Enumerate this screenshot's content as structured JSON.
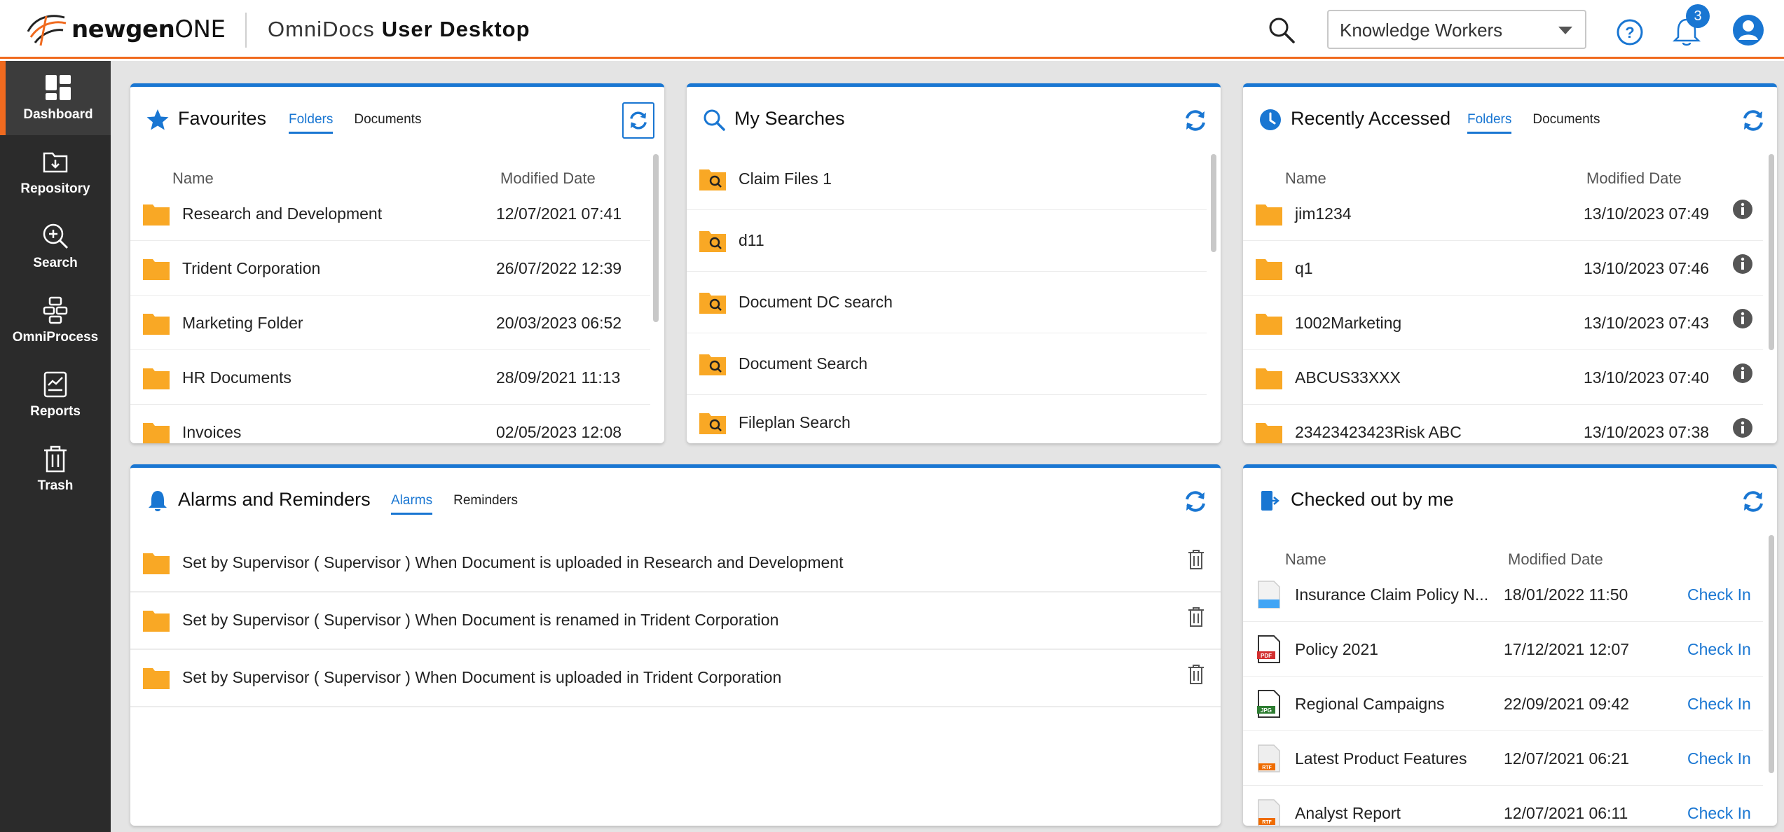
{
  "header": {
    "brand_main": "newgen",
    "brand_suffix": "ONE",
    "app_name": "OmniDocs",
    "app_subtitle": "User Desktop",
    "role_select": "Knowledge Workers",
    "notification_count": "3"
  },
  "sidebar": {
    "items": [
      {
        "label": "Dashboard",
        "icon": "dashboard-icon"
      },
      {
        "label": "Repository",
        "icon": "repository-icon"
      },
      {
        "label": "Search",
        "icon": "search-icon"
      },
      {
        "label": "OmniProcess",
        "icon": "omniprocess-icon"
      },
      {
        "label": "Reports",
        "icon": "reports-icon"
      },
      {
        "label": "Trash",
        "icon": "trash-icon"
      }
    ]
  },
  "favourites": {
    "title": "Favourites",
    "tabs": [
      "Folders",
      "Documents"
    ],
    "col_name": "Name",
    "col_date": "Modified Date",
    "rows": [
      {
        "name": "Research and Development",
        "date": "12/07/2021 07:41"
      },
      {
        "name": "Trident Corporation",
        "date": "26/07/2022 12:39"
      },
      {
        "name": "Marketing Folder",
        "date": "20/03/2023 06:52"
      },
      {
        "name": "HR Documents",
        "date": "28/09/2021 11:13"
      },
      {
        "name": "Invoices",
        "date": "02/05/2023 12:08"
      }
    ]
  },
  "searches": {
    "title": "My Searches",
    "rows": [
      "Claim Files 1",
      "d11",
      "Document DC search",
      "Document Search",
      "Fileplan Search"
    ]
  },
  "recent": {
    "title": "Recently Accessed",
    "tabs": [
      "Folders",
      "Documents"
    ],
    "col_name": "Name",
    "col_date": "Modified Date",
    "rows": [
      {
        "name": "jim1234",
        "date": "13/10/2023 07:49"
      },
      {
        "name": "q1",
        "date": "13/10/2023 07:46"
      },
      {
        "name": "1002Marketing",
        "date": "13/10/2023 07:43"
      },
      {
        "name": "ABCUS33XXX",
        "date": "13/10/2023 07:40"
      },
      {
        "name": "23423423423Risk ABC",
        "date": "13/10/2023 07:38"
      }
    ]
  },
  "alarms": {
    "title": "Alarms and Reminders",
    "tabs": [
      "Alarms",
      "Reminders"
    ],
    "rows": [
      "Set by Supervisor ( Supervisor ) When Document is uploaded in Research and Development",
      "Set by Supervisor ( Supervisor ) When Document is renamed in Trident Corporation",
      "Set by Supervisor ( Supervisor ) When Document is uploaded in Trident Corporation"
    ]
  },
  "checkedout": {
    "title": "Checked out by me",
    "col_name": "Name",
    "col_date": "Modified Date",
    "action": "Check In",
    "rows": [
      {
        "name": "Insurance Claim Policy N...",
        "date": "18/01/2022 11:50",
        "icon": "image-file-icon"
      },
      {
        "name": "Policy 2021",
        "date": "17/12/2021 12:07",
        "icon": "pdf-file-icon"
      },
      {
        "name": "Regional Campaigns",
        "date": "22/09/2021 09:42",
        "icon": "jpg-file-icon"
      },
      {
        "name": "Latest Product Features",
        "date": "12/07/2021 06:21",
        "icon": "rtf-file-icon"
      },
      {
        "name": "Analyst Report",
        "date": "12/07/2021 06:11",
        "icon": "rtf-file-icon"
      }
    ]
  },
  "colors": {
    "accent": "#1976d2",
    "brand_orange": "#f06a1f",
    "folder": "#f9a825",
    "sidebar": "#2b2b2b"
  }
}
